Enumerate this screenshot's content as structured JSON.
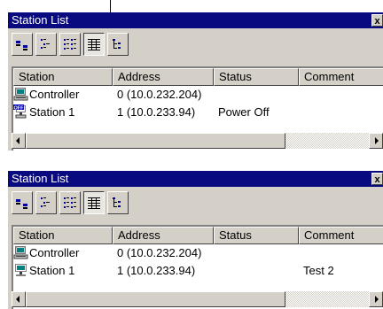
{
  "panels": [
    {
      "title": "Station List",
      "toolbar": [
        "large-icons",
        "small-icons",
        "list",
        "details",
        "tree"
      ],
      "pressed": "details",
      "columns": [
        "Station",
        "Address",
        "Status",
        "Comment"
      ],
      "rows": [
        {
          "icon": "controller-icon",
          "name": "Controller",
          "address": "0 (10.0.232.204)",
          "status": "",
          "comment": ""
        },
        {
          "icon": "station-off-icon",
          "name": "Station 1",
          "address": "1 (10.0.233.94)",
          "status": "Power Off",
          "comment": ""
        }
      ]
    },
    {
      "title": "Station List",
      "toolbar": [
        "large-icons",
        "small-icons",
        "list",
        "details",
        "tree"
      ],
      "pressed": "details",
      "columns": [
        "Station",
        "Address",
        "Status",
        "Comment"
      ],
      "rows": [
        {
          "icon": "controller-icon",
          "name": "Controller",
          "address": "0 (10.0.232.204)",
          "status": "",
          "comment": ""
        },
        {
          "icon": "station-icon",
          "name": "Station 1",
          "address": "1 (10.0.233.94)",
          "status": "",
          "comment": "Test 2"
        }
      ]
    }
  ],
  "close_glyph": "x"
}
